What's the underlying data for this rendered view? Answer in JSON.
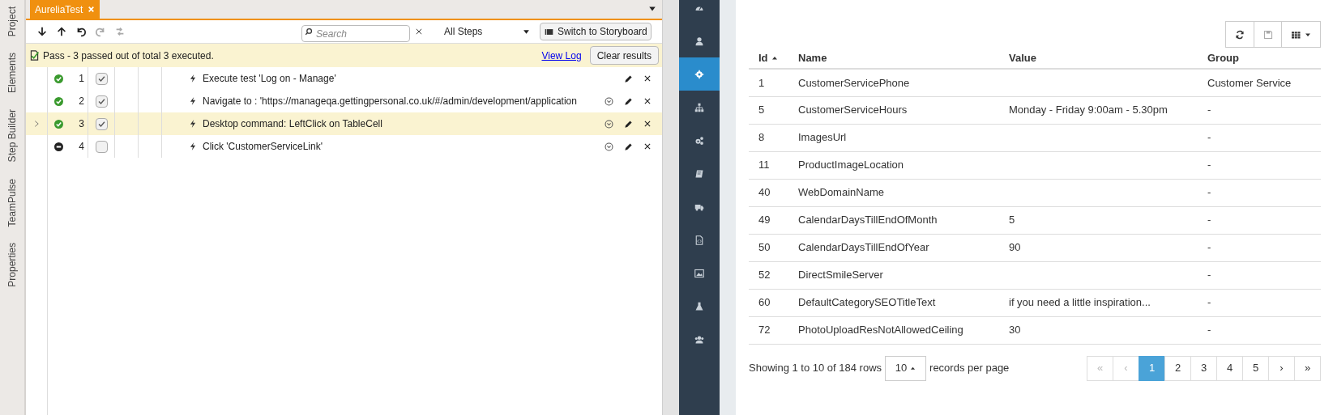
{
  "side_tabs": [
    "Project",
    "Elements",
    "Step Builder",
    "TeamPulse",
    "Properties"
  ],
  "editor": {
    "tabs": [
      {
        "label": "AureliaTest",
        "selected": true
      }
    ],
    "toolbar": {
      "search": {
        "placeholder": "Search"
      },
      "filter": "All Steps",
      "storyboard_button": "Switch to Storyboard"
    },
    "status": {
      "message": "Pass - 3 passed out of total 3 executed.",
      "link": "View Log",
      "button": "Clear results"
    },
    "steps": [
      {
        "number": "1",
        "kind": "passed",
        "checked": true,
        "selected": false,
        "text": "Execute test 'Log on - Manage'",
        "has_options": false
      },
      {
        "number": "2",
        "kind": "passed",
        "checked": true,
        "selected": false,
        "text": "Navigate to : 'https://manageqa.gettingpersonal.co.uk/#/admin/development/application",
        "has_options": true
      },
      {
        "number": "3",
        "kind": "passed",
        "checked": true,
        "selected": true,
        "text": "Desktop command: LeftClick on TableCell",
        "has_options": true
      },
      {
        "number": "4",
        "kind": "not_run",
        "checked": false,
        "selected": false,
        "text": "Click 'CustomerServiceLink'",
        "has_options": true
      }
    ]
  },
  "app": {
    "sidebar": {
      "items": [
        {
          "kind": "dashboard",
          "selected": false
        },
        {
          "kind": "user",
          "selected": false
        },
        {
          "kind": "gear",
          "selected": true
        },
        {
          "kind": "sitemap",
          "selected": false
        },
        {
          "kind": "gears",
          "selected": false
        },
        {
          "kind": "book",
          "selected": false
        },
        {
          "kind": "truck",
          "selected": false
        },
        {
          "kind": "file",
          "selected": false
        },
        {
          "kind": "image",
          "selected": false
        },
        {
          "kind": "flask",
          "selected": false
        },
        {
          "kind": "users",
          "selected": false
        }
      ]
    },
    "toolbar": [
      {
        "kind": "refresh",
        "disabled": false
      },
      {
        "kind": "save",
        "disabled": true
      },
      {
        "kind": "columns",
        "disabled": false
      }
    ],
    "table": {
      "columns": [
        {
          "label": "Id",
          "sorted": true
        },
        {
          "label": "Name",
          "sorted": false
        },
        {
          "label": "Value",
          "sorted": false
        },
        {
          "label": "Group",
          "sorted": false
        }
      ],
      "rows": [
        {
          "id": "1",
          "name": "CustomerServicePhone",
          "group": "Customer Service"
        },
        {
          "id": "5",
          "name": "CustomerServiceHours",
          "value": "Monday - Friday 9:00am - 5.30pm",
          "group": "-"
        },
        {
          "id": "8",
          "name": "ImagesUrl",
          "group": "-"
        },
        {
          "id": "11",
          "name": "ProductImageLocation",
          "group": "-"
        },
        {
          "id": "40",
          "name": "WebDomainName",
          "group": "-"
        },
        {
          "id": "49",
          "name": "CalendarDaysTillEndOfMonth",
          "value": "5",
          "group": "-"
        },
        {
          "id": "50",
          "name": "CalendarDaysTillEndOfYear",
          "value": "90",
          "group": "-"
        },
        {
          "id": "52",
          "name": "DirectSmileServer",
          "group": "-"
        },
        {
          "id": "60",
          "name": "DefaultCategorySEOTitleText",
          "value": "if you need a little inspiration...",
          "group": "-"
        },
        {
          "id": "72",
          "name": "PhotoUploadResNotAllowedCeiling",
          "value": "30",
          "group": "-"
        }
      ]
    },
    "footer": {
      "summary": "Showing 1 to 10 of 184 rows",
      "page_size": "10",
      "suffix": "records per page",
      "pages": [
        {
          "label": "«",
          "selected": false,
          "disabled": true
        },
        {
          "label": "‹",
          "selected": false,
          "disabled": true
        },
        {
          "label": "1",
          "selected": true,
          "disabled": false
        },
        {
          "label": "2",
          "selected": false,
          "disabled": false
        },
        {
          "label": "3",
          "selected": false,
          "disabled": false
        },
        {
          "label": "4",
          "selected": false,
          "disabled": false
        },
        {
          "label": "5",
          "selected": false,
          "disabled": false
        },
        {
          "label": "›",
          "selected": false,
          "disabled": false
        },
        {
          "label": "»",
          "selected": false,
          "disabled": false
        }
      ]
    }
  }
}
